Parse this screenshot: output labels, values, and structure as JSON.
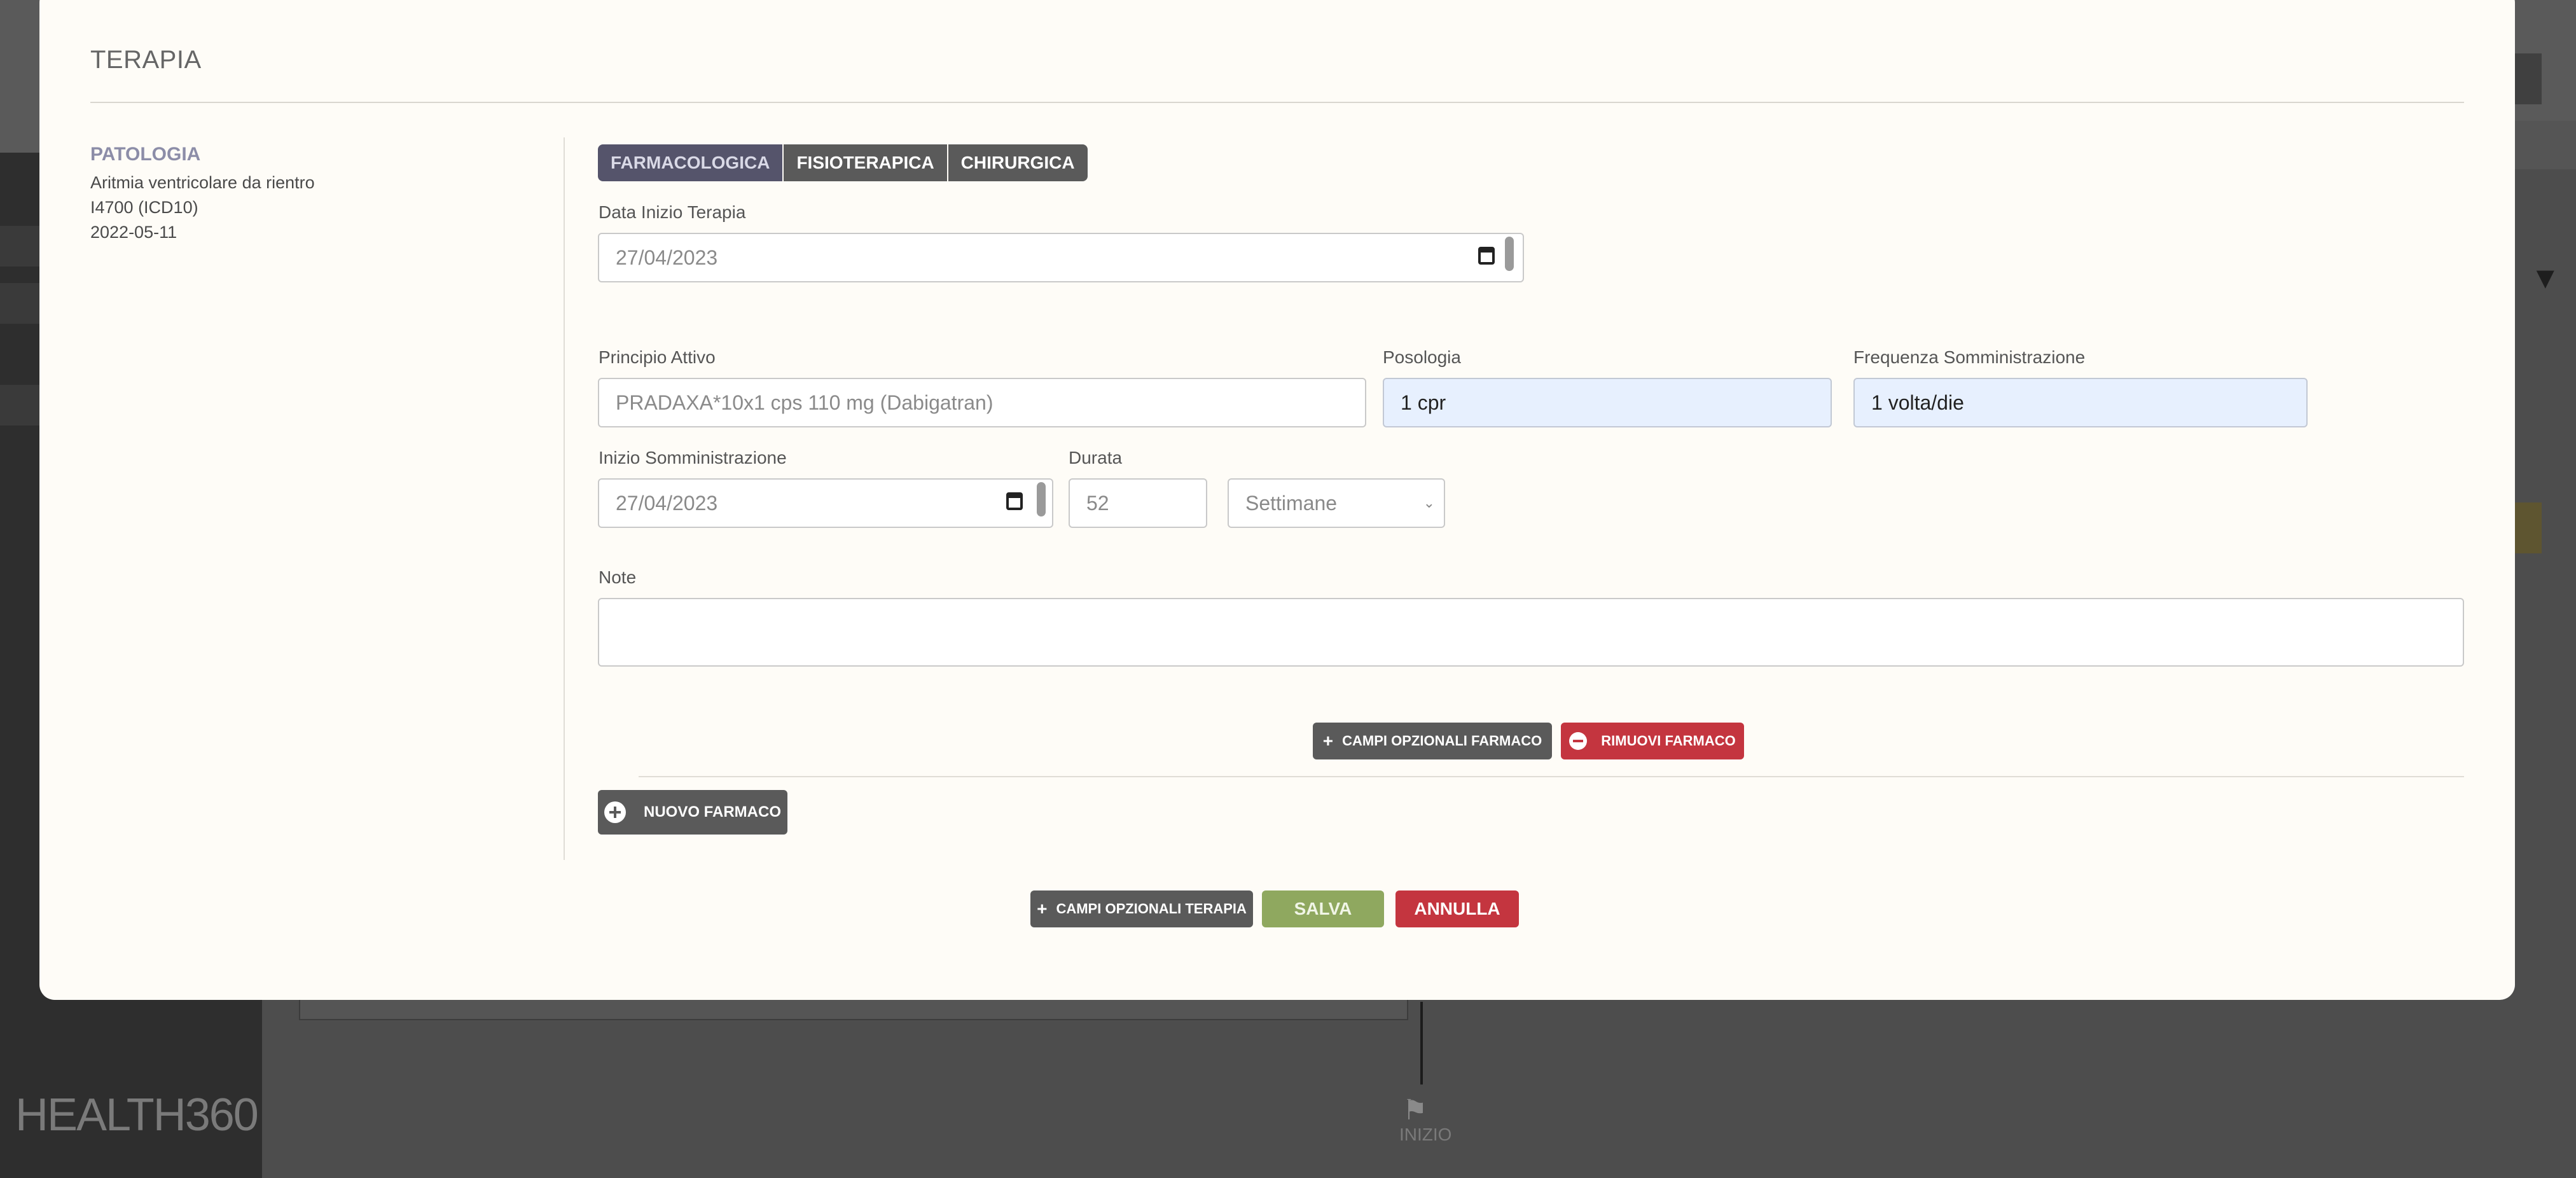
{
  "modal": {
    "title": "TERAPIA",
    "patologia": {
      "heading": "PATOLOGIA",
      "name": "Aritmia ventricolare da rientro",
      "code": "I4700 (ICD10)",
      "date": "2022-05-11"
    },
    "tabs": [
      {
        "label": "FARMACOLOGICA",
        "active": true
      },
      {
        "label": "FISIOTERAPICA",
        "active": false
      },
      {
        "label": "CHIRURGICA",
        "active": false
      }
    ],
    "data_inizio": {
      "label": "Data Inizio Terapia",
      "value": "27/04/2023"
    },
    "principio_attivo": {
      "label": "Principio Attivo",
      "value": "PRADAXA*10x1 cps 110 mg (Dabigatran)"
    },
    "posologia": {
      "label": "Posologia",
      "value": "1 cpr"
    },
    "frequenza": {
      "label": "Frequenza Somministrazione",
      "value": "1 volta/die"
    },
    "inizio_somministrazione": {
      "label": "Inizio Somministrazione",
      "value": "27/04/2023"
    },
    "durata": {
      "label": "Durata",
      "value": "52",
      "unit": "Settimane"
    },
    "note": {
      "label": "Note",
      "value": ""
    },
    "buttons": {
      "campi_opzionali_farmaco": "CAMPI OPZIONALI FARMACO",
      "rimuovi_farmaco": "RIMUOVI FARMACO",
      "nuovo_farmaco": "NUOVO FARMACO",
      "campi_opzionali_terapia": "CAMPI OPZIONALI TERAPIA",
      "salva": "SALVA",
      "annulla": "ANNULLA"
    },
    "colors": {
      "accent_green": "#8fa85f",
      "danger_red": "#c4353f",
      "dark_button": "#5a5a5a",
      "filled_input": "#e7f0fe"
    }
  },
  "background": {
    "logo": "HEALTH360",
    "start_label": "INIZIO"
  }
}
